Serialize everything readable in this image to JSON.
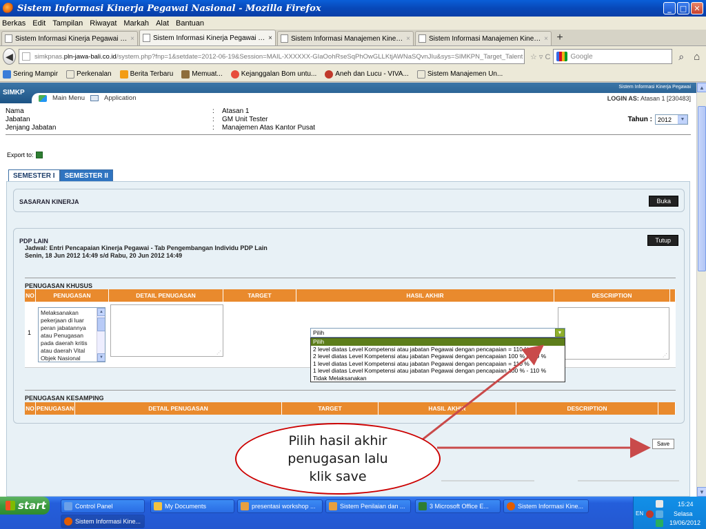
{
  "window": {
    "title": "Sistem Informasi Kinerja Pegawai Nasional - Mozilla Firefox",
    "btn_min": "_",
    "btn_max": "□",
    "btn_close": "✕"
  },
  "menu": [
    "Berkas",
    "Edit",
    "Tampilan",
    "Riwayat",
    "Markah",
    "Alat",
    "Bantuan"
  ],
  "tabs": [
    {
      "label": "Sistem Informasi Kinerja Pegawai Nasional",
      "close": "×"
    },
    {
      "label": "Sistem Informasi Kinerja Pegawai Nasional",
      "close": "×"
    },
    {
      "label": "Sistem Informasi Manajemen Kinerja Peg...",
      "close": "×"
    },
    {
      "label": "Sistem Informasi Manajemen Kinerja Peg...",
      "close": "×"
    }
  ],
  "new_tab": "+",
  "nav": {
    "url_prefix": "simkpnas.",
    "url_domain": "pln-jawa-bali.co.id",
    "url_rest": "/system.php?fnp=1&setdate=2012-06-19&Session=MAIL-XXXXXX-GIaOohRseSqPhOwGLLKtjAWNaSQvnJIu&sys=SIMKPN_Target_Talent",
    "url_icons": "☆ ▿ C",
    "search_placeholder": "Google"
  },
  "bookmarks": [
    {
      "label": "Sering Mampir",
      "color": "#3b7dd8"
    },
    {
      "label": "Perkenalan",
      "color": "#ffffff"
    },
    {
      "label": "Berita Terbaru",
      "color": "#f39c12"
    },
    {
      "label": "Memuat...",
      "color": "#8e6e3c"
    },
    {
      "label": "Kejanggalan Bom untu...",
      "color": "#e74c3c"
    },
    {
      "label": "Aneh dan Lucu - VIVA...",
      "color": "#c0392b"
    },
    {
      "label": "Sistem Manajemen Un...",
      "color": "#ffffff"
    }
  ],
  "app": {
    "logo": "SIMKP",
    "tagline": "Sistem Informasi Kinerja Pegawai",
    "main_menu": "Main Menu",
    "application": "Application",
    "login_label": "LOGIN AS:",
    "login_value": "Atasan 1 [230483]"
  },
  "profile": {
    "rows": [
      {
        "label": "Nama",
        "sep": ":",
        "value": "Atasan 1"
      },
      {
        "label": "Jabatan",
        "sep": ":",
        "value": "GM Unit Tester"
      },
      {
        "label": "Jenjang Jabatan",
        "sep": ":",
        "value": "Manajemen Atas Kantor Pusat"
      }
    ],
    "tahun_label": "Tahun :",
    "tahun_value": "2012"
  },
  "export_label": "Export to:",
  "semester_tabs": [
    "SEMESTER I",
    "SEMESTER II"
  ],
  "sasaran": {
    "title": "SASARAN KINERJA",
    "button": "Buka"
  },
  "pdp": {
    "title": "PDP LAIN",
    "button": "Tutup",
    "jadwal_line1": "Jadwal: Entri Pencapaian Kinerja Pegawai - Tab Pengembangan Individu PDP Lain",
    "jadwal_line2": "Senin, 18 Jun 2012 14:49 s/d Rabu, 20 Jun 2012 14:49"
  },
  "khusus": {
    "label": "PENUGASAN KHUSUS",
    "columns": [
      "NO",
      "PENUGASAN",
      "DETAIL PENUGASAN",
      "TARGET",
      "HASIL AKHIR",
      "DESCRIPTION"
    ],
    "row_no": "1",
    "penugasan_text": "Melaksanakan pekerjaan di luar peran jabatannya atau Penugasan pada daerah kritis atau daerah Vital Objek Nasional"
  },
  "hasil": {
    "selected": "Pilih",
    "options": [
      "Pilih",
      "2 level diatas Level Kompetensi atau jabatan Pegawai dengan pencapaian = 110 %",
      "2 level diatas Level Kompetensi atau jabatan Pegawai dengan pencapaian 100 % - 110 %",
      "1 level diatas Level Kompetensi atau jabatan Pegawai dengan pencapaian = 110 %",
      "1 level diatas Level Kompetensi atau jabatan Pegawai dengan pencapaian 100 % - 110 %",
      "Tidak Melaksanakan"
    ]
  },
  "kesamping": {
    "label": "PENUGASAN KESAMPING",
    "columns": [
      "NO",
      "PENUGASAN",
      "DETAIL PENUGASAN",
      "TARGET",
      "HASIL AKHIR",
      "DESCRIPTION"
    ]
  },
  "save_label": "Save",
  "callout": {
    "line1": "Pilih hasil akhir",
    "line2": "penugasan lalu",
    "line3": "klik save",
    "color": "#cc0000"
  },
  "taskbar": {
    "start": "start",
    "tasks": [
      "Control Panel",
      "My Documents",
      "presentasi workshop ...",
      "Sistem Penilaian dan ...",
      "3 Microsoft Office E...",
      "Sistem Informasi Kine...",
      "Sistem Informasi Kine..."
    ],
    "lang": "EN",
    "time": "15:24",
    "day": "Selasa",
    "date": "19/06/2012"
  }
}
